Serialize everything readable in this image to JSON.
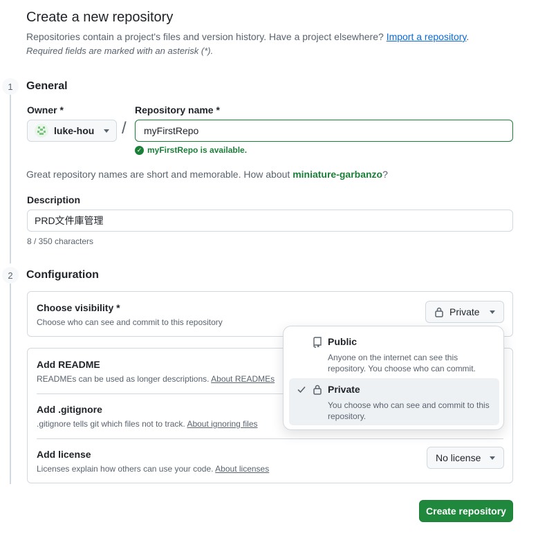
{
  "header": {
    "title": "Create a new repository",
    "intro_text": "Repositories contain a project's files and version history. Have a project elsewhere?",
    "import_link": "Import a repository",
    "intro_end": ".",
    "required_note": "Required fields are marked with an asterisk (*)."
  },
  "general": {
    "step": "1",
    "title": "General",
    "owner_label": "Owner *",
    "owner_value": "luke-hou",
    "repo_label": "Repository name *",
    "repo_value": "myFirstRepo",
    "availability": "myFirstRepo is available.",
    "suggest_prefix": "Great repository names are short and memorable. How about",
    "suggest_name": "miniature-garbanzo",
    "suggest_suffix": "?",
    "description_label": "Description",
    "description_value": "PRD文件庫管理",
    "char_count": "8 / 350 characters"
  },
  "configuration": {
    "step": "2",
    "title": "Configuration",
    "visibility": {
      "title": "Choose visibility *",
      "desc": "Choose who can see and commit to this repository",
      "selected": "Private"
    },
    "readme": {
      "title": "Add README",
      "desc": "READMEs can be used as longer descriptions.",
      "link": "About READMEs"
    },
    "gitignore": {
      "title": "Add .gitignore",
      "desc": ".gitignore tells git which files not to track.",
      "link": "About ignoring files"
    },
    "license": {
      "title": "Add license",
      "desc": "Licenses explain how others can use your code.",
      "link": "About licenses",
      "value": "No license"
    }
  },
  "visibility_menu": {
    "options": [
      {
        "title": "Public",
        "desc": "Anyone on the internet can see this repository. You choose who can commit."
      },
      {
        "title": "Private",
        "desc": "You choose who can see and commit to this repository."
      }
    ]
  },
  "footer": {
    "create_label": "Create repository"
  },
  "colors": {
    "accent_green": "#1f883d",
    "link_blue": "#0969da",
    "border": "#d1d9e0"
  }
}
